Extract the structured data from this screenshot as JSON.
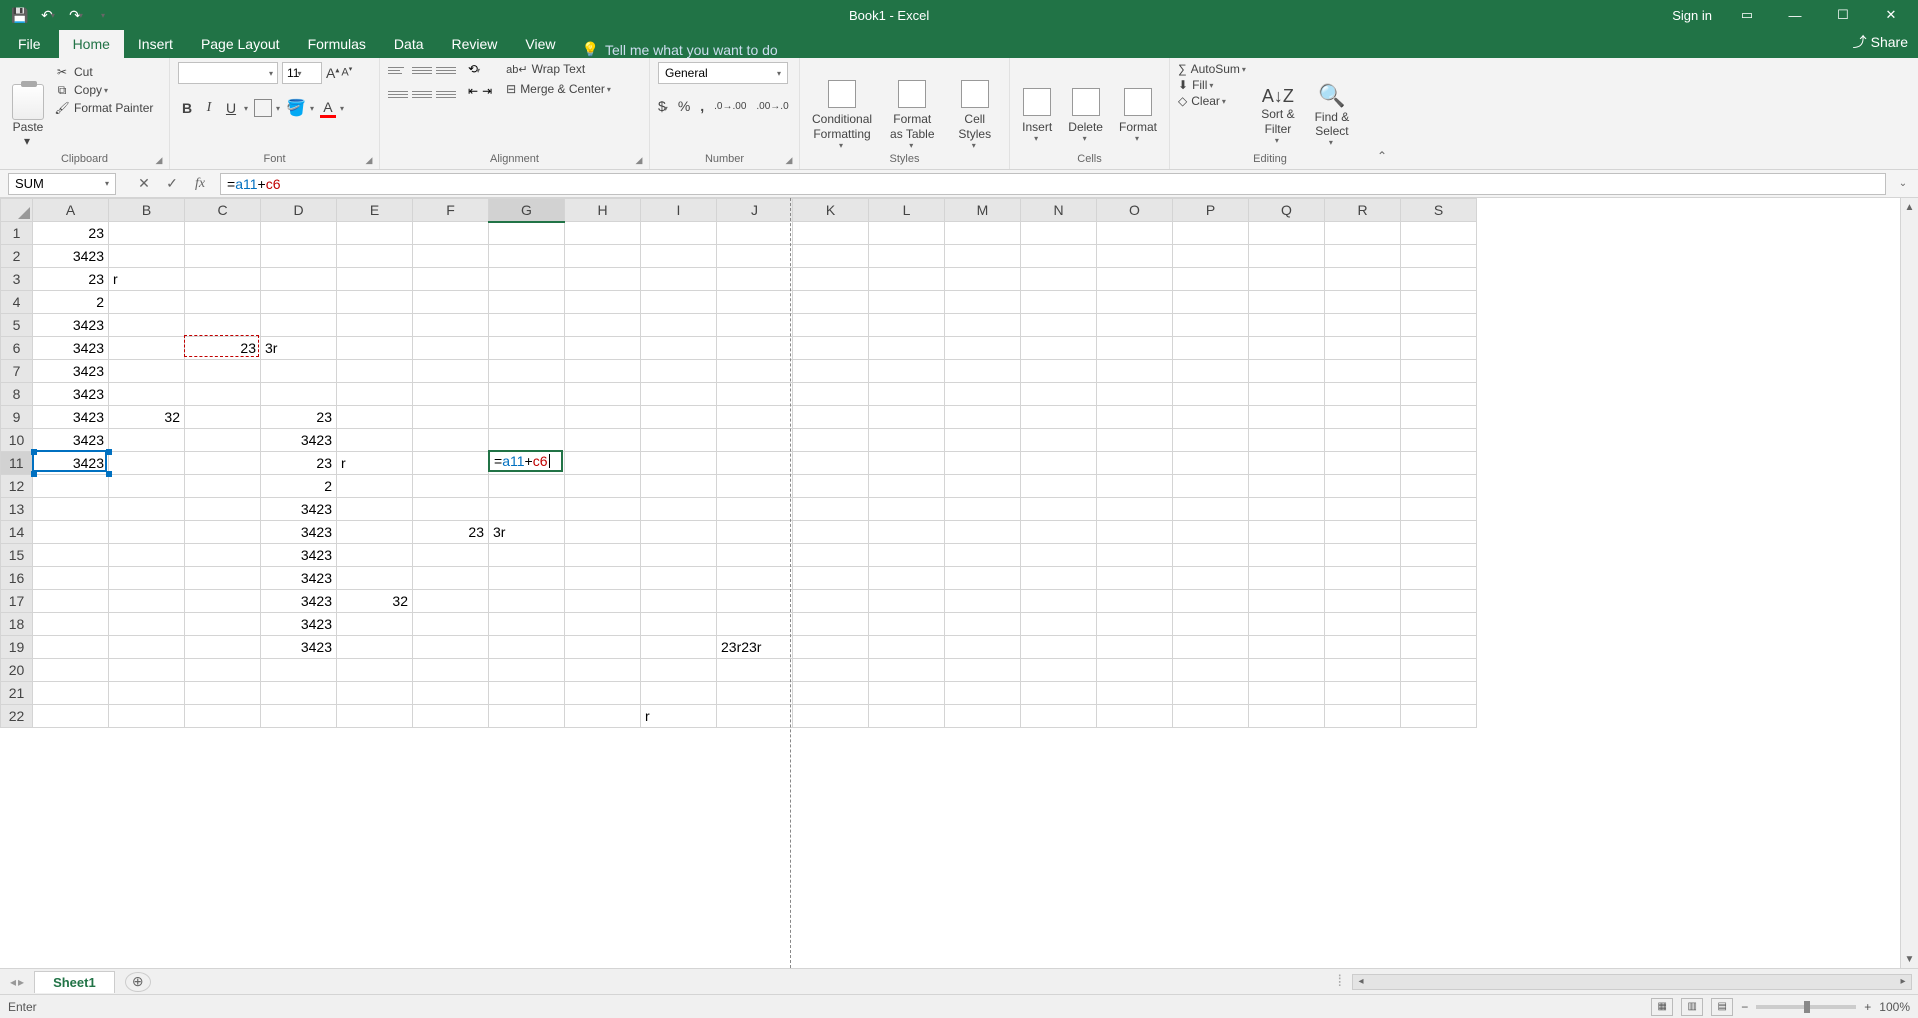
{
  "titlebar": {
    "title": "Book1  -  Excel",
    "signin": "Sign in"
  },
  "tabs": {
    "file": "File",
    "items": [
      "Home",
      "Insert",
      "Page Layout",
      "Formulas",
      "Data",
      "Review",
      "View"
    ],
    "active": "Home",
    "tell": "Tell me what you want to do",
    "share": "Share"
  },
  "ribbon": {
    "clipboard": {
      "label": "Clipboard",
      "paste": "Paste",
      "cut": "Cut",
      "copy": "Copy",
      "painter": "Format Painter"
    },
    "font": {
      "label": "Font",
      "name": "",
      "size": "11"
    },
    "alignment": {
      "label": "Alignment",
      "wrap": "Wrap Text",
      "merge": "Merge & Center"
    },
    "number": {
      "label": "Number",
      "format": "General"
    },
    "styles": {
      "label": "Styles",
      "cond": "Conditional Formatting",
      "table": "Format as Table",
      "cell": "Cell Styles"
    },
    "cells": {
      "label": "Cells",
      "insert": "Insert",
      "delete": "Delete",
      "format": "Format"
    },
    "editing": {
      "label": "Editing",
      "autosum": "AutoSum",
      "fill": "Fill",
      "clear": "Clear",
      "sort": "Sort & Filter",
      "find": "Find & Select"
    }
  },
  "formulabar": {
    "namebox": "SUM",
    "formula": "=a11+c6"
  },
  "columns": [
    "A",
    "B",
    "C",
    "D",
    "E",
    "F",
    "G",
    "H",
    "I",
    "J",
    "K",
    "L",
    "M",
    "N",
    "O",
    "P",
    "Q",
    "R",
    "S"
  ],
  "rows": 22,
  "cells": {
    "A1": "23",
    "A2": "3423",
    "A3": "23",
    "B3": "r",
    "A4": "2",
    "A5": "3423",
    "A6": "3423",
    "C6": "23",
    "D6": "3r",
    "A7": "3423",
    "A8": "3423",
    "A9": "3423",
    "B9": "32",
    "D9": "23",
    "A10": "3423",
    "D10": "3423",
    "A11": "3423",
    "D11": "23",
    "E11": "r",
    "G11": "=a11+c6",
    "A12": "",
    "D12": "2",
    "D13": "3423",
    "D14": "3423",
    "F14": "23",
    "G14": "3r",
    "D15": "3423",
    "D16": "3423",
    "D17": "3423",
    "E17": "32",
    "D18": "3423",
    "D19": "3423",
    "J19": "23r23r",
    "I22": "r"
  },
  "text_cells": [
    "B3",
    "D6",
    "E11",
    "G11",
    "G14",
    "J19",
    "I22"
  ],
  "active": {
    "cell": "G11",
    "row": 11,
    "col": "G",
    "value": "=a11+c6"
  },
  "refs": [
    {
      "cell": "A11",
      "color": "blue"
    },
    {
      "cell": "C6",
      "color": "red"
    }
  ],
  "sheets": {
    "active": "Sheet1"
  },
  "status": {
    "mode": "Enter",
    "zoom": "100%"
  }
}
